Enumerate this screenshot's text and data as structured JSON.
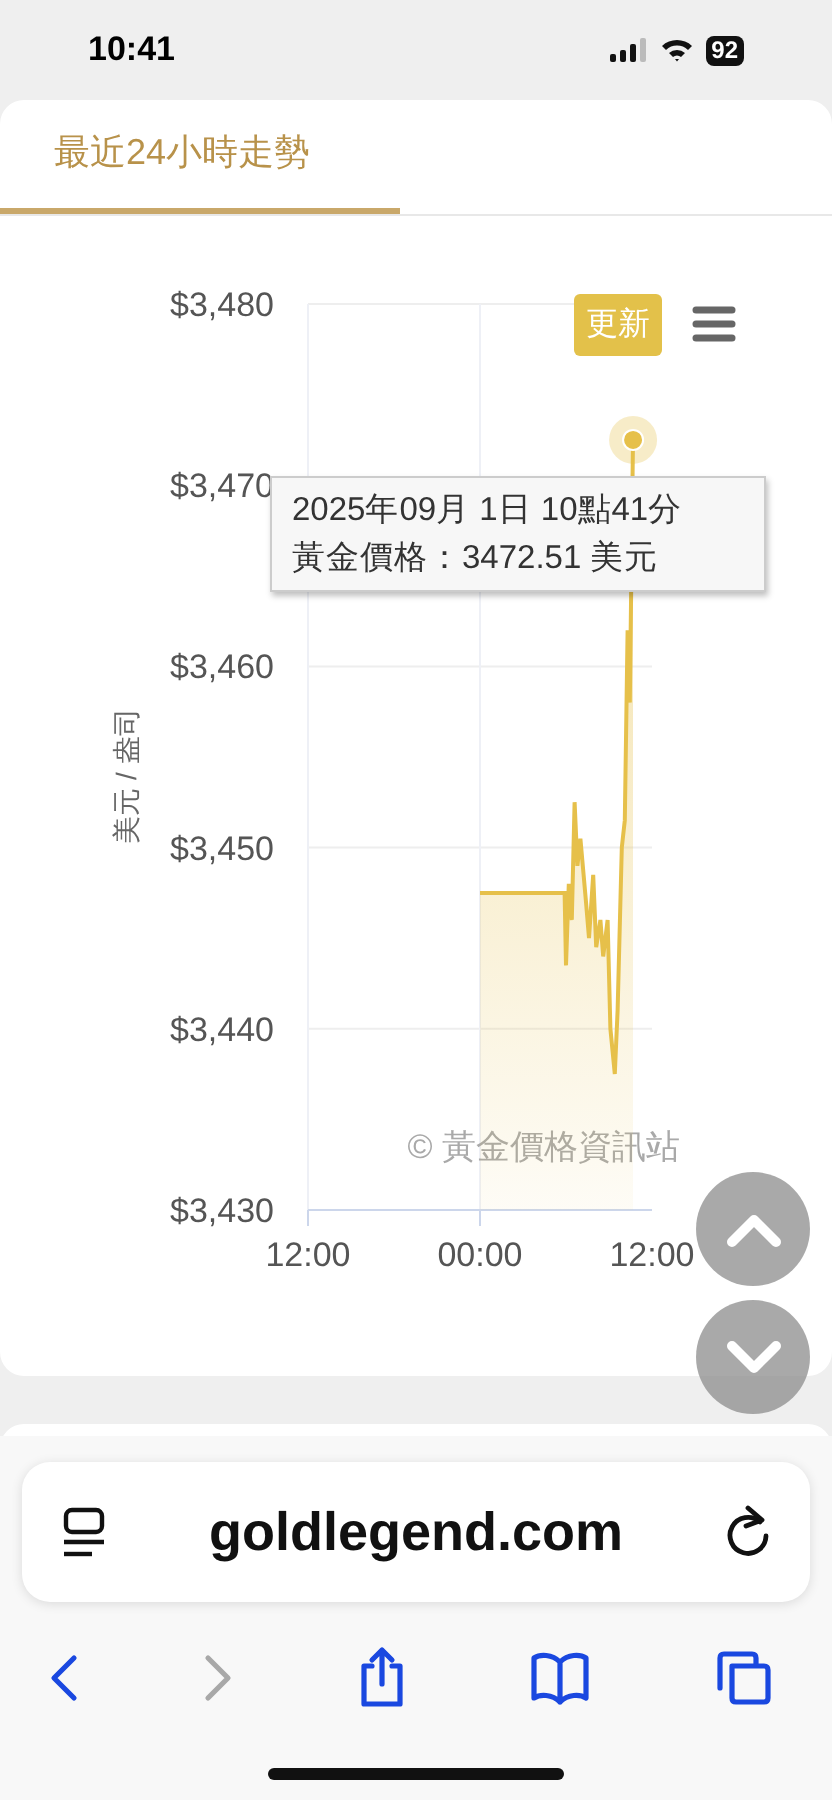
{
  "status_bar": {
    "time": "10:41",
    "battery": "92"
  },
  "tabs": [
    {
      "label": "最近24小時走勢",
      "selected": true
    }
  ],
  "chart": {
    "update_button": "更新",
    "watermark": "© 黃金價格資訊站",
    "tooltip": {
      "lines": [
        "2025年09月 1日 10點41分",
        "黃金價格：3472.51 美元"
      ]
    },
    "chart_data": {
      "type": "area",
      "ylabel": "美元 / 盎司",
      "x": [
        0,
        5.9,
        6.0,
        6.2,
        6.4,
        6.6,
        6.8,
        7.0,
        7.4,
        7.6,
        7.9,
        8.1,
        8.4,
        8.6,
        8.9,
        9.1,
        9.4,
        9.6,
        9.9,
        10.1,
        10.3,
        10.45,
        10.68
      ],
      "series": [
        {
          "color": "#e6c04a",
          "values": [
            3447.5,
            3447.5,
            3443.5,
            3448,
            3446,
            3452.5,
            3449,
            3450.5,
            3447,
            3445,
            3448.5,
            3444.5,
            3446,
            3444,
            3446,
            3440,
            3437.5,
            3441,
            3450,
            3451.5,
            3462,
            3458,
            3472.5
          ]
        }
      ],
      "xlim": [
        -12,
        12
      ],
      "ylim": [
        3430,
        3480
      ],
      "grid": true,
      "xticks": [
        {
          "value": -12,
          "label": "12:00"
        },
        {
          "value": 0,
          "label": "00:00"
        },
        {
          "value": 12,
          "label": "12:00"
        }
      ],
      "yticks": [
        {
          "value": 3430,
          "label": "$3,430"
        },
        {
          "value": 3440,
          "label": "$3,440"
        },
        {
          "value": 3450,
          "label": "$3,450"
        },
        {
          "value": 3460,
          "label": "$3,460"
        },
        {
          "value": 3470,
          "label": "$3,470"
        },
        {
          "value": 3480,
          "label": "$3,480"
        }
      ]
    }
  },
  "browser": {
    "url": "goldlegend.com",
    "toolbar": [
      {
        "kind": "back",
        "disabled": false
      },
      {
        "kind": "forward",
        "disabled": true
      },
      {
        "kind": "share",
        "disabled": false
      },
      {
        "kind": "bookmarks",
        "disabled": false
      },
      {
        "kind": "tabs",
        "disabled": false
      }
    ]
  }
}
